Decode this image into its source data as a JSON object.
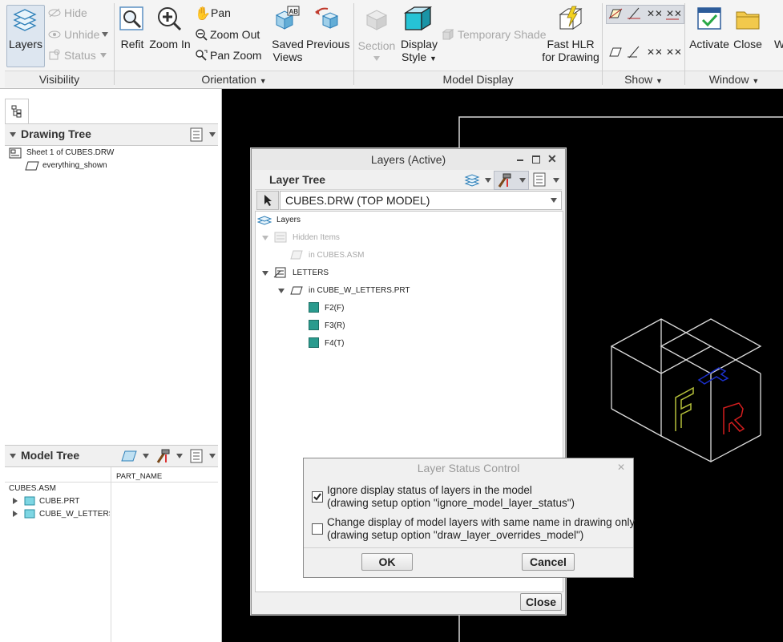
{
  "ribbon": {
    "visibility": {
      "layers_label": "Layers",
      "hide_label": "Hide",
      "unhide_label": "Unhide",
      "status_label": "Status",
      "group_label": "Visibility"
    },
    "orientation": {
      "refit_label": "Refit",
      "zoom_in_label": "Zoom In",
      "pan_label": "Pan",
      "zoom_out_label": "Zoom Out",
      "pan_zoom_label": "Pan Zoom",
      "saved_views_label_1": "Saved",
      "saved_views_label_2": "Views",
      "previous_label": "Previous",
      "group_label": "Orientation"
    },
    "model_display": {
      "section_label": "Section",
      "display_style_label_1": "Display",
      "display_style_label_2": "Style",
      "temporary_shade_label": "Temporary Shade",
      "fast_hlr_label_1": "Fast HLR",
      "fast_hlr_label_2": "for Drawing",
      "group_label": "Model Display"
    },
    "show": {
      "group_label": "Show"
    },
    "window": {
      "activate_label": "Activate",
      "close_label": "Close",
      "group_label": "Window"
    }
  },
  "drawing_tree": {
    "title": "Drawing Tree",
    "items": [
      "Sheet 1 of CUBES.DRW",
      "everything_shown"
    ]
  },
  "model_tree": {
    "title": "Model Tree",
    "column_header": "PART_NAME",
    "root": "CUBES.ASM",
    "items": [
      "CUBE.PRT",
      "CUBE_W_LETTERS.!"
    ]
  },
  "layers_dialog": {
    "title": "Layers (Active)",
    "layer_tree_label": "Layer Tree",
    "model_select": "CUBES.DRW (TOP MODEL)",
    "tree": {
      "root": "Layers",
      "hidden_items": "Hidden Items",
      "in_cubes_asm": "in CUBES.ASM",
      "letters": "LETTERS",
      "in_part": "in CUBE_W_LETTERS.PRT",
      "features": [
        "F2(F)",
        "F3(R)",
        "F4(T)"
      ]
    },
    "close_button": "Close"
  },
  "status_dialog": {
    "title": "Layer Status Control",
    "option1_line1": "Ignore display status of layers in the model",
    "option1_line2": "(drawing setup option \"ignore_model_layer_status\")",
    "option1_checked": true,
    "option2_line1": "Change display of model layers with same name in drawing only",
    "option2_line2": "(drawing setup option \"draw_layer_overrides_model\")",
    "option2_checked": false,
    "ok_label": "OK",
    "cancel_label": "Cancel"
  },
  "viewport": {
    "letters": [
      "F",
      "R",
      "T"
    ],
    "colors": {
      "background": "#000000",
      "letter_f": "#b5c03a",
      "letter_r": "#d21e1e",
      "letter_t": "#1b2fc8",
      "edges": "#dcdcdc"
    }
  }
}
